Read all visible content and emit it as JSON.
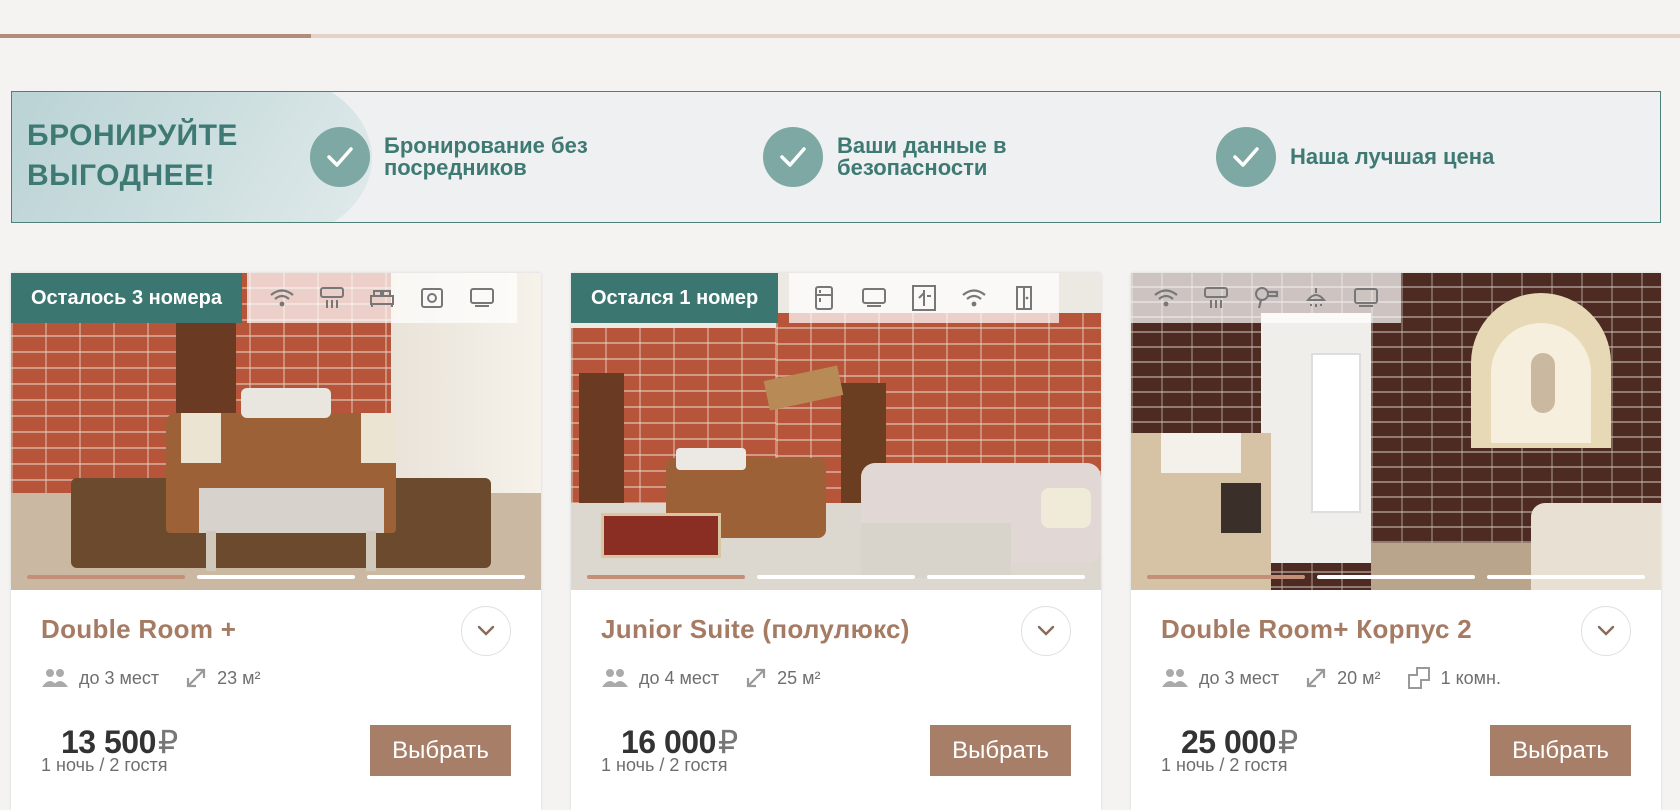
{
  "progress": {
    "fraction": 0.185
  },
  "promo": {
    "title": "БРОНИРУЙТЕ ВЫГОДНЕЕ!",
    "items": [
      {
        "text": "Бронирование без посредников",
        "icon": "check-icon"
      },
      {
        "text": "Ваши данные в безопасности",
        "icon": "check-icon"
      },
      {
        "text": "Наша лучшая цена",
        "icon": "check-icon"
      }
    ]
  },
  "cards": [
    {
      "badge": "Осталось 3 номера",
      "amenities": [
        "wifi-icon",
        "air-conditioner-icon",
        "bed-icon",
        "safe-icon",
        "tv-icon"
      ],
      "slide": {
        "active": 1,
        "total": 3
      },
      "title": "Double Room +",
      "guests": "до 3 мест",
      "area": "23 м²",
      "rooms": "",
      "price": "13 500",
      "currency": "₽",
      "price_note": "1 ночь / 2 гостя",
      "button": "Выбрать"
    },
    {
      "badge": "Остался 1 номер",
      "amenities": [
        "fridge-icon",
        "tv-icon",
        "wardrobe-icon",
        "wifi-icon",
        "door-icon"
      ],
      "slide": {
        "active": 1,
        "total": 3
      },
      "title": "Junior Suite (полулюкс)",
      "guests": "до 4 мест",
      "area": "25 м²",
      "rooms": "",
      "price": "16 000",
      "currency": "₽",
      "price_note": "1 ночь / 2 гостя",
      "button": "Выбрать"
    },
    {
      "badge": "",
      "amenities": [
        "wifi-icon",
        "air-conditioner-icon",
        "hairdryer-icon",
        "shower-icon",
        "tv-icon"
      ],
      "slide": {
        "active": 1,
        "total": 3
      },
      "title": "Double Room+ Корпус 2",
      "guests": "до 3 мест",
      "area": "20 м²",
      "rooms": "1 комн.",
      "price": "25 000",
      "currency": "₽",
      "price_note": "1 ночь / 2 гостя",
      "button": "Выбрать"
    }
  ],
  "colors": {
    "accent": "#3c7670",
    "brown": "#a77e67",
    "title_brown": "#a57b64"
  }
}
